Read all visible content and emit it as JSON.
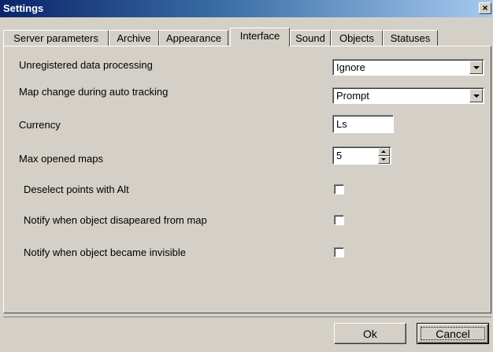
{
  "window": {
    "title": "Settings",
    "close_glyph": "×"
  },
  "tabs": [
    {
      "label": "Server parameters",
      "active": false
    },
    {
      "label": "Archive",
      "active": false
    },
    {
      "label": "Appearance",
      "active": false
    },
    {
      "label": "Interface",
      "active": true
    },
    {
      "label": "Sound",
      "active": false
    },
    {
      "label": "Objects",
      "active": false
    },
    {
      "label": "Statuses",
      "active": false
    }
  ],
  "settings": {
    "unregistered": {
      "label": "Unregistered data processing",
      "value": "Ignore"
    },
    "map_change": {
      "label": "Map change during auto tracking",
      "value": "Prompt"
    },
    "currency": {
      "label": "Currency",
      "value": "Ls"
    },
    "max_maps": {
      "label": "Max opened maps",
      "value": "5"
    },
    "deselect_alt": {
      "label": "Deselect points with Alt",
      "checked": false
    },
    "notify_disappeared": {
      "label": "Notify when object disapeared from map",
      "checked": false
    },
    "notify_invisible": {
      "label": "Notify when object became invisible",
      "checked": false
    }
  },
  "buttons": {
    "ok": "Ok",
    "cancel": "Cancel"
  },
  "colors": {
    "titlebar_start": "#0a246a",
    "titlebar_end": "#a6caf0",
    "face": "#d4d0c8"
  }
}
